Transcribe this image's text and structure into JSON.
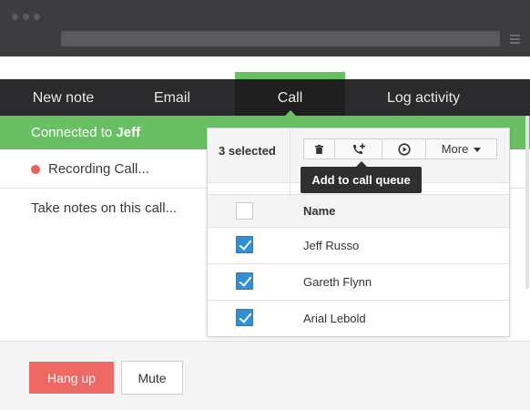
{
  "tabs": [
    {
      "label": "New note",
      "active": false
    },
    {
      "label": "Email",
      "active": false
    },
    {
      "label": "Call",
      "active": true
    },
    {
      "label": "Log activity",
      "active": false
    }
  ],
  "call": {
    "connected_prefix": "Connected to",
    "connected_name": "Jeff",
    "recording_label": "Recording Call...",
    "notes_placeholder": "Take notes on this call..."
  },
  "popup": {
    "selected_count": "3 selected",
    "toolbar": {
      "delete_icon": "trash-icon",
      "queue_icon": "phone-plus-icon",
      "play_icon": "play-circle-icon",
      "more_label": "More"
    },
    "tooltip": "Add to call queue",
    "column_header": "Name",
    "rows": [
      {
        "name": "Jeff Russo",
        "checked": true
      },
      {
        "name": "Gareth Flynn",
        "checked": true
      },
      {
        "name": "Arial Lebold",
        "checked": true
      }
    ]
  },
  "actions": {
    "hang_up": "Hang up",
    "mute": "Mute"
  },
  "colors": {
    "accent_green": "#68c063",
    "record_red": "#ec5f5b",
    "hangup_red": "#ee6964",
    "checkbox_blue": "#2f8fd0",
    "chrome_dark": "#3d3d3f",
    "tab_bar": "#2b2b2d"
  }
}
